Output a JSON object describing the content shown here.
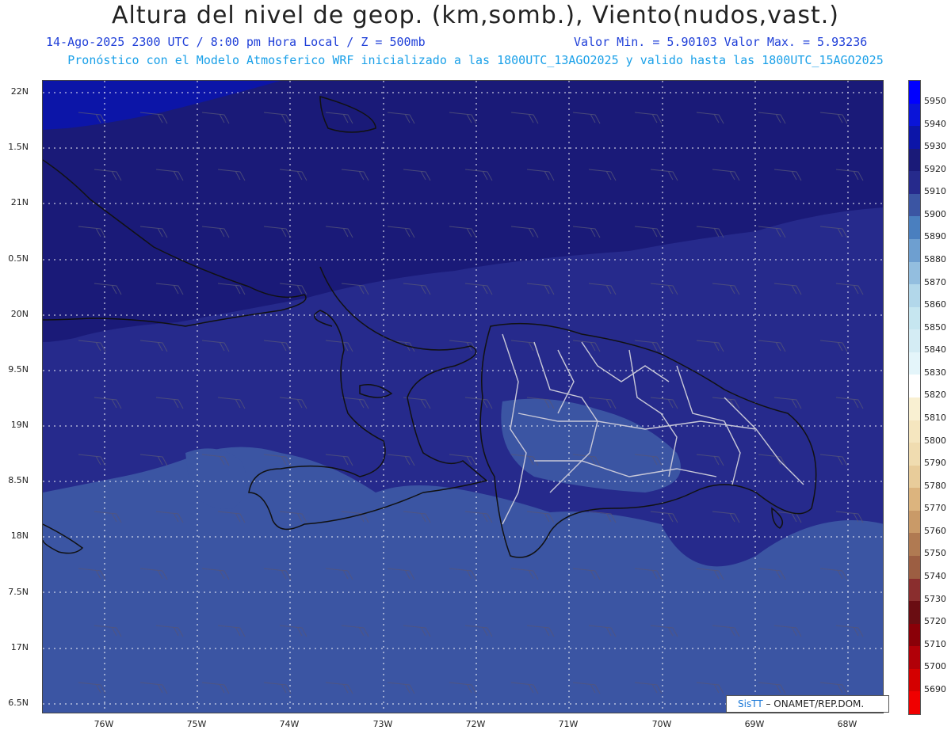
{
  "title": "Altura del nivel de geop. (km,somb.), Viento(nudos,vast.)",
  "subtitle_left": "14-Ago-2025  2300 UTC / 8:00 pm Hora Local / Z = 500mb",
  "subtitle_right": "Valor Min. = 5.90103  Valor Max. = 5.93236",
  "subtitle2": "Pronóstico con el Modelo Atmosferico WRF inicializado a las 1800UTC_13AGO2025 y valido hasta las  1800UTC_15AGO2025",
  "lat_labels": [
    "22N",
    "1.5N",
    "21N",
    "0.5N",
    "20N",
    "9.5N",
    "19N",
    "8.5N",
    "18N",
    "7.5N",
    "17N",
    "6.5N"
  ],
  "lon_labels": [
    "76W",
    "75W",
    "74W",
    "73W",
    "72W",
    "71W",
    "70W",
    "69W",
    "68W"
  ],
  "colorbar": {
    "labels": [
      "5950",
      "5940",
      "5930",
      "5920",
      "5910",
      "5900",
      "5890",
      "5880",
      "5870",
      "5860",
      "5850",
      "5840",
      "5830",
      "5820",
      "5810",
      "5800",
      "5790",
      "5780",
      "5770",
      "5760",
      "5750",
      "5740",
      "5730",
      "5720",
      "5710",
      "5700",
      "5690"
    ],
    "colors": [
      "#0000ff",
      "#0a14d8",
      "#0c15a8",
      "#1a1a78",
      "#262a8c",
      "#3b55a3",
      "#4a7fbf",
      "#6e9fd0",
      "#93bedf",
      "#b2d7ea",
      "#c6e6f0",
      "#d4ecf4",
      "#e4f5fa",
      "#ffffff",
      "#f9f0d2",
      "#f5e6bf",
      "#f0dcb0",
      "#e8cc9a",
      "#dcb47e",
      "#c99a68",
      "#b07a52",
      "#9c5e42",
      "#8a2e2e",
      "#6a0d12",
      "#8a0008",
      "#b10008",
      "#d40000",
      "#f00000"
    ]
  },
  "credit": {
    "brand": "SisTT",
    "text": "– ONAMET/REP.DOM."
  },
  "colors": {
    "deep": "#0c15a8",
    "band1": "#1a1a78",
    "band2": "#262a8c",
    "band3": "#3b55a3",
    "land": "#222",
    "provinces": "#c8c8d8"
  }
}
